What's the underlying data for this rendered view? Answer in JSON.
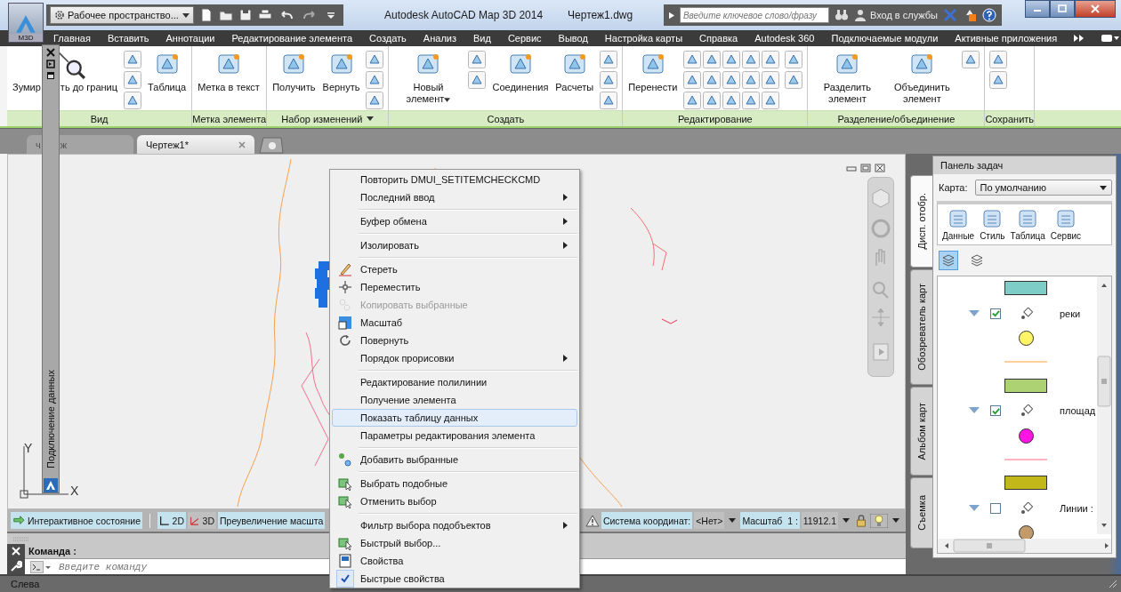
{
  "title_bar": {
    "app_label": "M3D",
    "workspace": "Рабочее пространство...",
    "title": "Autodesk AutoCAD Map 3D 2014",
    "file": "Чертеж1.dwg",
    "search": {
      "placeholder": "Введите ключевое слово/фразу"
    },
    "sign_in": "Вход в службы"
  },
  "menu_tabs": [
    "Главная",
    "Вставить",
    "Аннотации",
    "Редактирование элемента",
    "Создать",
    "Анализ",
    "Вид",
    "Сервис",
    "Вывод",
    "Настройка карты",
    "Справка",
    "Autodesk 360",
    "Подключаемые модули",
    "Активные приложения"
  ],
  "ribbon": {
    "panels": [
      {
        "title": "Вид",
        "has_menu": false,
        "items": [
          {
            "kind": "covered",
            "parts": [
              "Зумир",
              "ть до границ"
            ]
          },
          {
            "kind": "icons"
          },
          {
            "kind": "large",
            "label": "Таблица"
          }
        ]
      },
      {
        "title": "Метка элемента",
        "has_menu": false,
        "items": [
          {
            "kind": "large",
            "label": "Метка в текст"
          }
        ]
      },
      {
        "title": "Набор изменений",
        "has_menu": true,
        "items": [
          {
            "kind": "large",
            "label": "Получить"
          },
          {
            "kind": "large",
            "label": "Вернуть"
          },
          {
            "kind": "icons"
          }
        ]
      },
      {
        "title": "Создать",
        "has_menu": false,
        "items": [
          {
            "kind": "large_menu",
            "label": "Новый элемент"
          },
          {
            "kind": "icons"
          },
          {
            "kind": "large",
            "label": "Соединения"
          },
          {
            "kind": "large",
            "label": "Расчеты"
          },
          {
            "kind": "icons"
          }
        ]
      },
      {
        "title": "Редактирование",
        "has_menu": false,
        "items": [
          {
            "kind": "large",
            "label": "Перенести"
          },
          {
            "kind": "icons"
          },
          {
            "kind": "icons"
          }
        ]
      },
      {
        "title": "Разделение/объединение",
        "has_menu": false,
        "items": [
          {
            "kind": "large",
            "label": "Разделить элемент"
          },
          {
            "kind": "large",
            "label": "Объединить элемент"
          },
          {
            "kind": "icons"
          }
        ]
      },
      {
        "title": "Сохранить",
        "has_menu": false,
        "items": [
          {
            "kind": "icons"
          }
        ]
      }
    ]
  },
  "doc_tabs": [
    {
      "parts": [
        "ч",
        "ж"
      ],
      "selected": false
    },
    {
      "parts": [
        "Чертеж1*"
      ],
      "selected": true
    }
  ],
  "palette": {
    "title": "Подключение данных"
  },
  "ucs": {
    "y_label": "Y",
    "x_label": "X"
  },
  "context_menu": [
    {
      "kind": "item",
      "label": "Повторить DMUI_SETITEMCHECKCMD",
      "submenu": false,
      "disabled": false,
      "selected": false,
      "checked": false
    },
    {
      "kind": "item",
      "label": "Последний ввод",
      "submenu": true,
      "disabled": false,
      "selected": false,
      "checked": false
    },
    {
      "kind": "separator"
    },
    {
      "kind": "item",
      "label": "Буфер обмена",
      "submenu": true,
      "disabled": false,
      "selected": false,
      "checked": false
    },
    {
      "kind": "separator"
    },
    {
      "kind": "item",
      "label": "Изолировать",
      "submenu": true,
      "disabled": false,
      "selected": false,
      "checked": false
    },
    {
      "kind": "separator"
    },
    {
      "kind": "item",
      "label": "Стереть",
      "submenu": false,
      "disabled": false,
      "selected": false,
      "checked": false
    },
    {
      "kind": "item",
      "label": "Переместить",
      "submenu": false,
      "disabled": false,
      "selected": false,
      "checked": false
    },
    {
      "kind": "item",
      "label": "Копировать выбранные",
      "submenu": false,
      "disabled": true,
      "selected": false,
      "checked": false
    },
    {
      "kind": "item",
      "label": "Масштаб",
      "submenu": false,
      "disabled": false,
      "selected": false,
      "checked": false
    },
    {
      "kind": "item",
      "label": "Повернуть",
      "submenu": false,
      "disabled": false,
      "selected": false,
      "checked": false
    },
    {
      "kind": "item",
      "label": "Порядок прорисовки",
      "submenu": true,
      "disabled": false,
      "selected": false,
      "checked": false
    },
    {
      "kind": "separator"
    },
    {
      "kind": "item",
      "label": "Редактирование полилинии",
      "submenu": false,
      "disabled": false,
      "selected": false,
      "checked": false
    },
    {
      "kind": "item",
      "label": "Получение элемента",
      "submenu": false,
      "disabled": false,
      "selected": false,
      "checked": false
    },
    {
      "kind": "item",
      "label": "Показать таблицу данных",
      "submenu": false,
      "disabled": false,
      "selected": true,
      "checked": false
    },
    {
      "kind": "item",
      "label": "Параметры редактирования элемента",
      "submenu": false,
      "disabled": false,
      "selected": false,
      "checked": false
    },
    {
      "kind": "separator"
    },
    {
      "kind": "item",
      "label": "Добавить выбранные",
      "submenu": false,
      "disabled": false,
      "selected": false,
      "checked": false
    },
    {
      "kind": "separator"
    },
    {
      "kind": "item",
      "label": "Выбрать подобные",
      "submenu": false,
      "disabled": false,
      "selected": false,
      "checked": false
    },
    {
      "kind": "item",
      "label": "Отменить выбор",
      "submenu": false,
      "disabled": false,
      "selected": false,
      "checked": false
    },
    {
      "kind": "separator"
    },
    {
      "kind": "item",
      "label": "Фильтр выбора подобъектов",
      "submenu": true,
      "disabled": false,
      "selected": false,
      "checked": false
    },
    {
      "kind": "item",
      "label": "Быстрый выбор...",
      "submenu": false,
      "disabled": false,
      "selected": false,
      "checked": false
    },
    {
      "kind": "item",
      "label": "Свойства",
      "submenu": false,
      "disabled": false,
      "selected": false,
      "checked": false
    },
    {
      "kind": "item",
      "label": "Быстрые свойства",
      "submenu": false,
      "disabled": false,
      "selected": false,
      "checked": true
    }
  ],
  "status_row": {
    "interactive": "Интерактивное состояние",
    "view_2d": "2D",
    "view_3d": "3D",
    "exaggeration": "Преувеличение масшта",
    "coord_label": "Система координат:",
    "coord_value": "<Нет>",
    "scale_label": "Масштаб  1 :",
    "scale_value": "11912.1"
  },
  "command": {
    "label": "Команда :",
    "placeholder": "Введите команду"
  },
  "bottom_status": "Слева",
  "task_pane": {
    "title": "Панель задач",
    "side_tabs": [
      {
        "label": "Дисп. отобр.",
        "selected": true
      },
      {
        "label": "Обозреватель карт",
        "selected": false
      },
      {
        "label": "Альбом карт",
        "selected": false
      },
      {
        "label": "Съемка",
        "selected": false
      }
    ],
    "map_label": "Карта:",
    "map_value": "По умолчанию",
    "tools": [
      "Данные",
      "Стиль",
      "Таблица",
      "Сервис"
    ],
    "view_buttons": [
      {
        "selected": true
      },
      {
        "selected": false
      }
    ],
    "layers": [
      {
        "name": "реки",
        "checked": true,
        "styles": [
          {
            "kind": "area",
            "color": "#7ecdc6"
          },
          {
            "kind": "point",
            "color": "#fff466"
          },
          {
            "kind": "line",
            "color": "#ffd09a"
          }
        ]
      },
      {
        "name": "площад",
        "checked": true,
        "styles": [
          {
            "kind": "area",
            "color": "#add273"
          },
          {
            "kind": "point",
            "color": "#ff14e4"
          },
          {
            "kind": "line",
            "color": "#ffb4c0"
          }
        ]
      },
      {
        "name": "Линии :",
        "checked": false,
        "styles": [
          {
            "kind": "area",
            "color": "#c2b81a"
          },
          {
            "kind": "point",
            "color": "#c39a6a"
          }
        ]
      }
    ]
  }
}
